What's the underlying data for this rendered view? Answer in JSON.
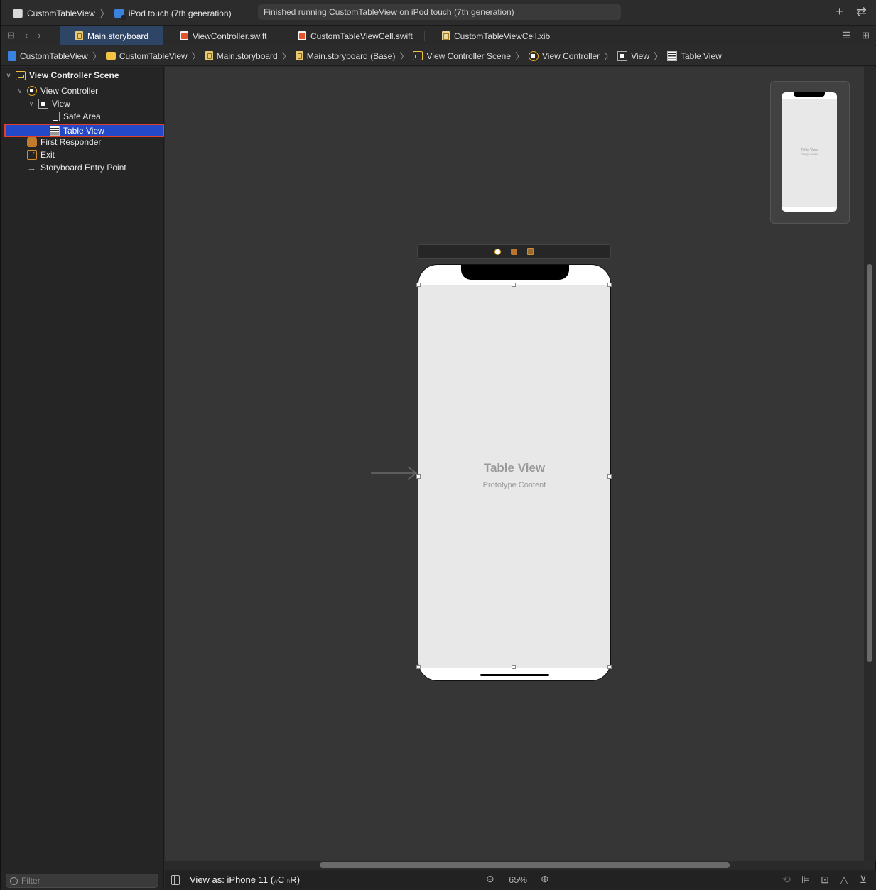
{
  "toolbar": {
    "scheme_name": "CustomTableView",
    "device_name": "iPod touch (7th generation)",
    "status_text": "Finished running CustomTableView on iPod touch (7th generation)",
    "add_icon": "plus-icon",
    "swap_icon": "arrows-swap-icon"
  },
  "tabs": [
    {
      "label": "Main.storyboard",
      "icon": "storyboard-icon",
      "active": true
    },
    {
      "label": "ViewController.swift",
      "icon": "swift-icon",
      "active": false
    },
    {
      "label": "CustomTableViewCell.swift",
      "icon": "swift-icon",
      "active": false
    },
    {
      "label": "CustomTableViewCell.xib",
      "icon": "xib-icon",
      "active": false
    }
  ],
  "jumpbar": [
    {
      "label": "CustomTableView",
      "icon": "project-icon"
    },
    {
      "label": "CustomTableView",
      "icon": "folder-icon"
    },
    {
      "label": "Main.storyboard",
      "icon": "storyboard-icon"
    },
    {
      "label": "Main.storyboard (Base)",
      "icon": "storyboard-icon"
    },
    {
      "label": "View Controller Scene",
      "icon": "scene-icon"
    },
    {
      "label": "View Controller",
      "icon": "view-controller-icon"
    },
    {
      "label": "View",
      "icon": "view-icon"
    },
    {
      "label": "Table View",
      "icon": "table-view-icon"
    }
  ],
  "outline": [
    {
      "label": "View Controller Scene",
      "level": 0,
      "expanded": true,
      "icon": "scene-icon"
    },
    {
      "label": "View Controller",
      "level": 1,
      "expanded": true,
      "icon": "view-controller-icon"
    },
    {
      "label": "View",
      "level": 2,
      "expanded": true,
      "icon": "view-icon"
    },
    {
      "label": "Safe Area",
      "level": 3,
      "icon": "safe-area-icon"
    },
    {
      "label": "Table View",
      "level": 3,
      "icon": "table-view-icon",
      "selected": true
    },
    {
      "label": "First Responder",
      "level": 1,
      "icon": "first-responder-icon"
    },
    {
      "label": "Exit",
      "level": 1,
      "icon": "exit-icon"
    },
    {
      "label": "Storyboard Entry Point",
      "level": 1,
      "icon": "entry-arrow-icon"
    }
  ],
  "filter": {
    "placeholder": "Filter"
  },
  "canvas": {
    "table_view_title": "Table View",
    "table_view_subtitle": "Prototype Content",
    "minimap_title": "Table View",
    "minimap_subtitle": "Prototype Content"
  },
  "bottombar": {
    "view_as_prefix": "View as: iPhone 11 (",
    "width_class_label": "w",
    "width_class": "C",
    "height_class_label": "h",
    "height_class": "R",
    "view_as_suffix": ")",
    "zoom_level": "65%"
  },
  "colors": {
    "selection": "#2348c8",
    "selection_outline": "#e0402c",
    "active_tab": "#2f4566"
  }
}
